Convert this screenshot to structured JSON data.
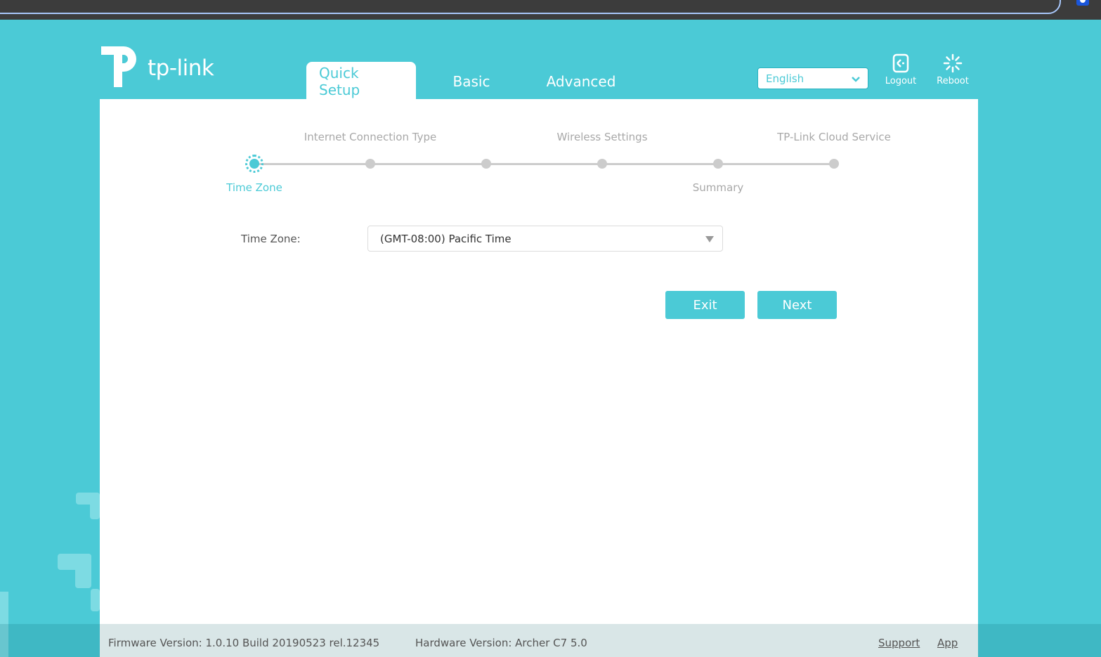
{
  "browser": {
    "url": "http://192.168.1.1/webpages_c7v5_20220414/index.html?_gl=1*bjhs6y*_gcl_au*MjAxMjQwMDc0NS4xNzI0ODM5Mzg5*_ga*YWYwLXZDcz30TVowbik4R0tNTVdqYT0Td0E.*_ga_X5XJFE5KZ4*MTc"
  },
  "header": {
    "logo_text": "tp-link",
    "tabs": [
      {
        "label": "Quick Setup",
        "active": true
      },
      {
        "label": "Basic",
        "active": false
      },
      {
        "label": "Advanced",
        "active": false
      }
    ],
    "language": {
      "selected": "English"
    },
    "logout_label": "Logout",
    "reboot_label": "Reboot"
  },
  "wizard": {
    "steps": [
      {
        "label": "Time Zone",
        "position": "below",
        "active": true
      },
      {
        "label": "Internet Connection Type",
        "position": "above",
        "active": false
      },
      {
        "label": "",
        "position": "none",
        "active": false
      },
      {
        "label": "Wireless Settings",
        "position": "above",
        "active": false
      },
      {
        "label": "Summary",
        "position": "below",
        "active": false
      },
      {
        "label": "TP-Link Cloud Service",
        "position": "above",
        "active": false
      }
    ],
    "current_step": 1,
    "total_steps": 6
  },
  "form": {
    "time_zone_label": "Time Zone:",
    "time_zone_value": "(GMT-08:00) Pacific Time",
    "exit_label": "Exit",
    "next_label": "Next"
  },
  "footer": {
    "firmware": "Firmware Version: 1.0.10 Build 20190523 rel.12345",
    "hardware": "Hardware Version: Archer C7 5.0",
    "support_label": "Support",
    "app_label": "App"
  },
  "colors": {
    "brand": "#4bcad6",
    "inactive_step": "#cccccc",
    "footer_bg": "#d9e6e7"
  }
}
